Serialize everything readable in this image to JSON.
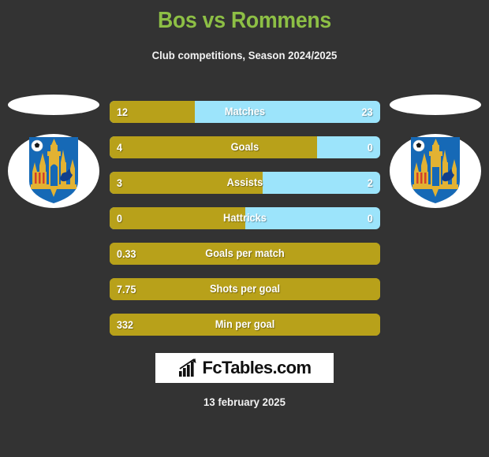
{
  "header": {
    "title": "Bos vs Rommens",
    "subtitle": "Club competitions, Season 2024/2025",
    "title_color": "#8dbf45"
  },
  "colors": {
    "background": "#333333",
    "home_bar": "#b8a11a",
    "away_bar": "#9ce4fb",
    "text": "#ffffff"
  },
  "teams": {
    "home": {
      "crest_name": "den-bosch-crest"
    },
    "away": {
      "crest_name": "den-bosch-crest"
    }
  },
  "stats": [
    {
      "label": "Matches",
      "home": "12",
      "away": "23",
      "home_pct": 31.5,
      "split": true
    },
    {
      "label": "Goals",
      "home": "4",
      "away": "0",
      "home_pct": 76.7,
      "split": true
    },
    {
      "label": "Assists",
      "home": "3",
      "away": "2",
      "home_pct": 56.6,
      "split": true
    },
    {
      "label": "Hattricks",
      "home": "0",
      "away": "0",
      "home_pct": 50.1,
      "split": true
    },
    {
      "label": "Goals per match",
      "home": "0.33",
      "away": "",
      "home_pct": 100,
      "split": false
    },
    {
      "label": "Shots per goal",
      "home": "7.75",
      "away": "",
      "home_pct": 100,
      "split": false
    },
    {
      "label": "Min per goal",
      "home": "332",
      "away": "",
      "home_pct": 100,
      "split": false
    }
  ],
  "footer": {
    "brand": "FcTables.com",
    "brand_icon": "bar-chart-arrow-icon",
    "date": "13 february 2025"
  }
}
